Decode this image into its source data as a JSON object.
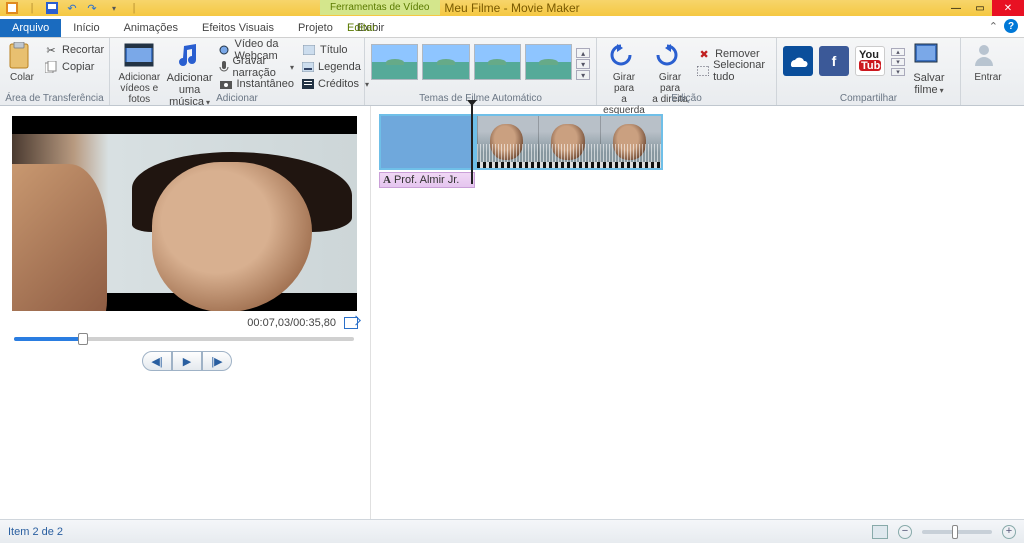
{
  "app": {
    "tool_context_tab": "Ferramentas de Vídeo",
    "title": "Meu Filme - Movie Maker"
  },
  "tabs": {
    "arquivo": "Arquivo",
    "inicio": "Início",
    "animacoes": "Animações",
    "efeitos": "Efeitos Visuais",
    "projeto": "Projeto",
    "exibir": "Exibir",
    "editar": "Editar"
  },
  "ribbon": {
    "clipboard": {
      "colar": "Colar",
      "recortar": "Recortar",
      "copiar": "Copiar",
      "group": "Área de Transferência"
    },
    "add": {
      "videos_fotos": "Adicionar\nvídeos e fotos",
      "musica": "Adicionar\numa música",
      "webcam": "Vídeo da Webcam",
      "narracao": "Gravar narração",
      "instantaneo": "Instantâneo",
      "titulo": "Título",
      "legenda": "Legenda",
      "creditos": "Créditos",
      "group": "Adicionar"
    },
    "themes": {
      "group": "Temas de Filme Automático"
    },
    "edit": {
      "girar_esq": "Girar para\na esquerda",
      "girar_dir": "Girar para\na direita",
      "remover": "Remover",
      "selecionar": "Selecionar tudo",
      "group": "Edição"
    },
    "share": {
      "salvar": "Salvar\nfilme",
      "group": "Compartilhar"
    },
    "signin": {
      "entrar": "Entrar"
    }
  },
  "preview": {
    "time": "00:07,03/00:35,80"
  },
  "timeline": {
    "caption_author": "Prof. Almir Jr."
  },
  "status": {
    "item_count": "Item 2 de 2"
  }
}
